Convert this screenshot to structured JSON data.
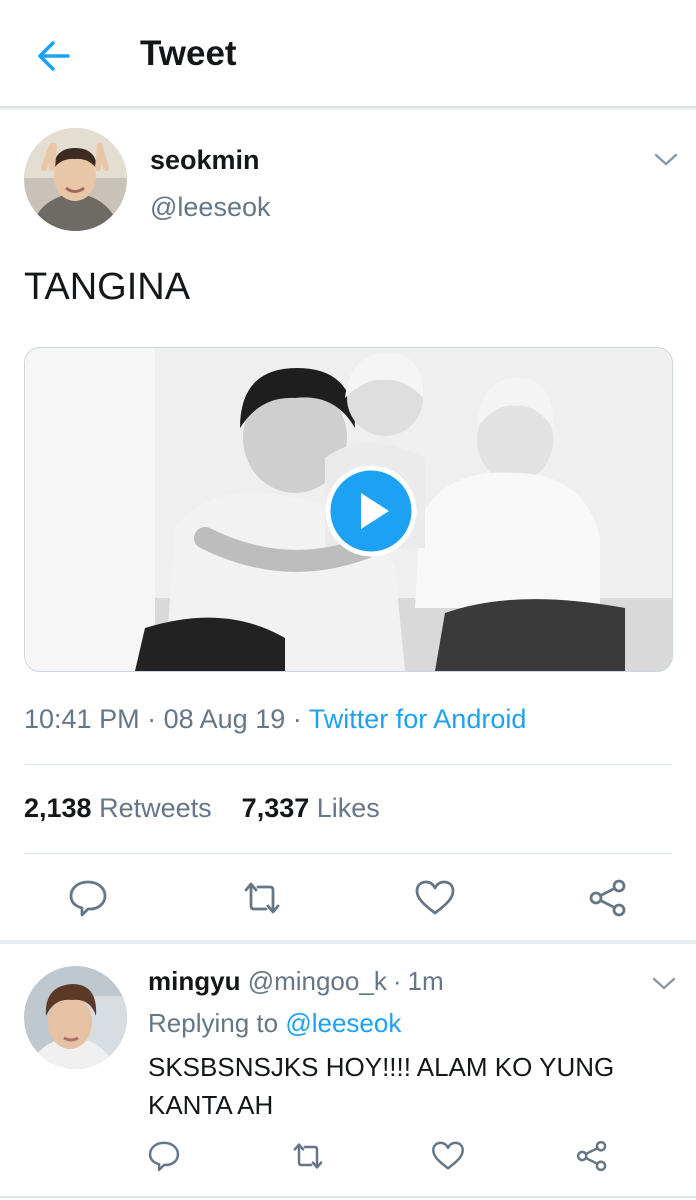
{
  "header": {
    "title": "Tweet",
    "back_icon": "arrow-left-icon"
  },
  "tweet": {
    "display_name": "seokmin",
    "handle": "@leeseok",
    "text": "TANGINA",
    "media": {
      "type": "video",
      "play_icon": "play-icon"
    },
    "time": "10:41 PM",
    "date": "08 Aug 19",
    "separator": "·",
    "source": "Twitter for Android",
    "retweets_count": "2,138",
    "retweets_label": "Retweets",
    "likes_count": "7,337",
    "likes_label": "Likes",
    "actions": [
      "reply-icon",
      "retweet-icon",
      "like-icon",
      "share-icon"
    ]
  },
  "reply": {
    "display_name": "mingyu",
    "handle": "@mingoo_k",
    "separator": "·",
    "time": "1m",
    "replying_prefix": "Replying to",
    "replying_to": "@leeseok",
    "text": "SKSBSNSJKS HOY!!!! ALAM KO YUNG KANTA AH",
    "actions": [
      "reply-icon",
      "retweet-icon",
      "like-icon",
      "share-icon"
    ]
  },
  "colors": {
    "accent": "#1da1f2",
    "secondary_text": "#657786",
    "primary_text": "#14171a",
    "divider": "#e1e8ed"
  }
}
